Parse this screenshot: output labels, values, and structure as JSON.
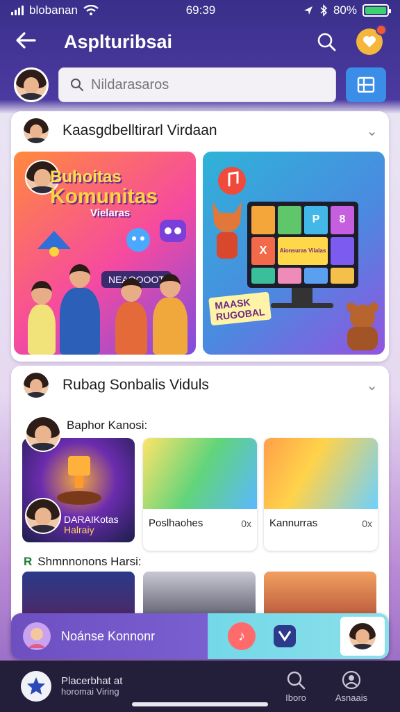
{
  "status_bar": {
    "carrier": "blobanan",
    "time": "69:39",
    "battery": "80%"
  },
  "header": {
    "title": "Asplturibsai"
  },
  "search": {
    "placeholder": "Nildarasaros"
  },
  "section1": {
    "title": "Kaasgdbelltirarl Virdaan",
    "promo_line1": "Buhoitas",
    "promo_line2": "Komunitas",
    "promo_line3": "Vielaras",
    "promo_tag": "NEAOOOOT",
    "tile2_tag_line1": "MAASK",
    "tile2_tag_line2": "RUGOBAL",
    "monitor_cells": [
      "",
      "",
      "P",
      "8",
      "X",
      "Aionsuras Vilalas",
      "",
      "",
      "",
      "",
      "",
      ""
    ]
  },
  "section2": {
    "title": "Rubag Sonbalis Viduls",
    "subheading": "Baphor Kanosi:",
    "feature_caption_line1": "DARAIKotas",
    "feature_caption_line2": "Halraiy",
    "thumbs": [
      {
        "label": "Poslhaohes",
        "close": "0x"
      },
      {
        "label": "Kannurras",
        "close": "0x"
      }
    ],
    "subheading2": "Shmnnonons Harsi:",
    "subheading2_prefix": "R"
  },
  "float_bar": {
    "label": "Noánse Konnonr"
  },
  "bottom_nav": {
    "title": "Placerbhat at",
    "subtitle": "horomai Viring",
    "tab1": "Iboro",
    "tab2": "Asnaais"
  },
  "colors": {
    "header_bg": "#3a2f8a",
    "accent_blue": "#3a8ee8",
    "nav_bg": "#231e3a"
  }
}
